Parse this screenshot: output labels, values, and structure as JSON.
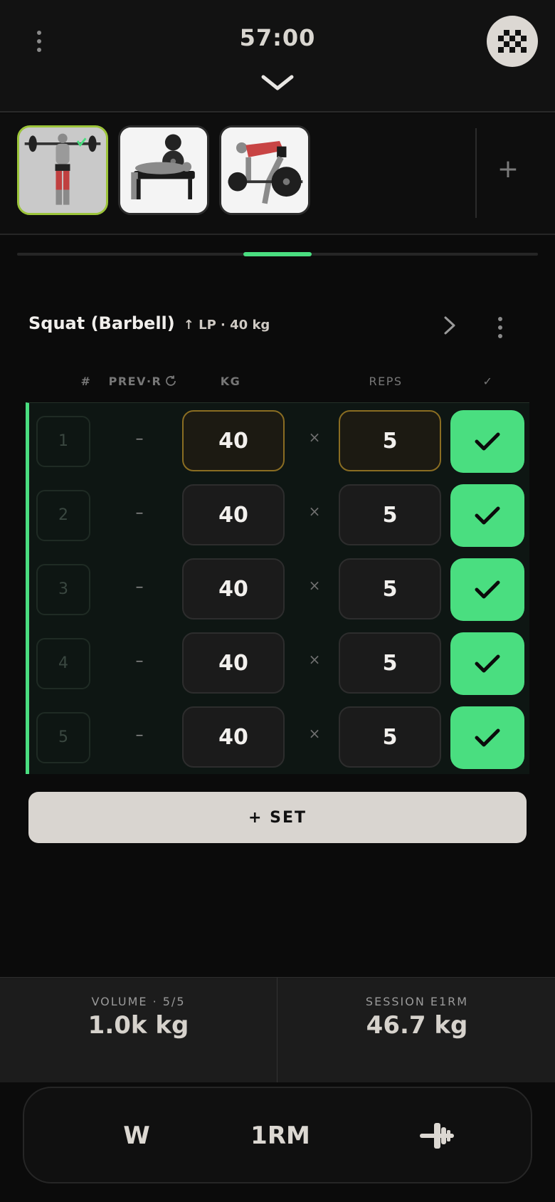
{
  "header": {
    "timer": "57:00"
  },
  "exercises": [
    {
      "name": "Squat (Barbell)",
      "active": true,
      "completed": true
    },
    {
      "name": "Bench Press (Barbell)",
      "active": false,
      "completed": false
    },
    {
      "name": "Bent Over Row (Barbell)",
      "active": false,
      "completed": false
    }
  ],
  "add_exercise_label": "+",
  "progress": {
    "current_index": 1,
    "total": 3
  },
  "exercise": {
    "name": "Squat (Barbell)",
    "subtitle": "↑ LP · 40 kg"
  },
  "table": {
    "headers": {
      "num": "#",
      "prev": "PREV·R",
      "kg": "KG",
      "reps": "REPS",
      "done": "✓"
    },
    "sets": [
      {
        "num": "1",
        "prev": "–",
        "kg": "40",
        "sep": "×",
        "reps": "5",
        "done": true,
        "highlighted": true
      },
      {
        "num": "2",
        "prev": "–",
        "kg": "40",
        "sep": "×",
        "reps": "5",
        "done": true,
        "highlighted": false
      },
      {
        "num": "3",
        "prev": "–",
        "kg": "40",
        "sep": "×",
        "reps": "5",
        "done": true,
        "highlighted": false
      },
      {
        "num": "4",
        "prev": "–",
        "kg": "40",
        "sep": "×",
        "reps": "5",
        "done": true,
        "highlighted": false
      },
      {
        "num": "5",
        "prev": "–",
        "kg": "40",
        "sep": "×",
        "reps": "5",
        "done": true,
        "highlighted": false
      }
    ]
  },
  "add_set_label": "+ SET",
  "stats": {
    "volume_label": "VOLUME · 5/5",
    "volume_value": "1.0k kg",
    "e1rm_label": "SESSION E1RM",
    "e1rm_value": "46.7 kg"
  },
  "toolbar": {
    "warmup_label": "W",
    "one_rm_label": "1RM",
    "plate_icon": "plate-calculator-icon"
  },
  "colors": {
    "accent": "#4ade80",
    "highlight_border": "#8a6d22",
    "active_thumb_border": "#9cc43a",
    "background": "#0b0b0b"
  }
}
